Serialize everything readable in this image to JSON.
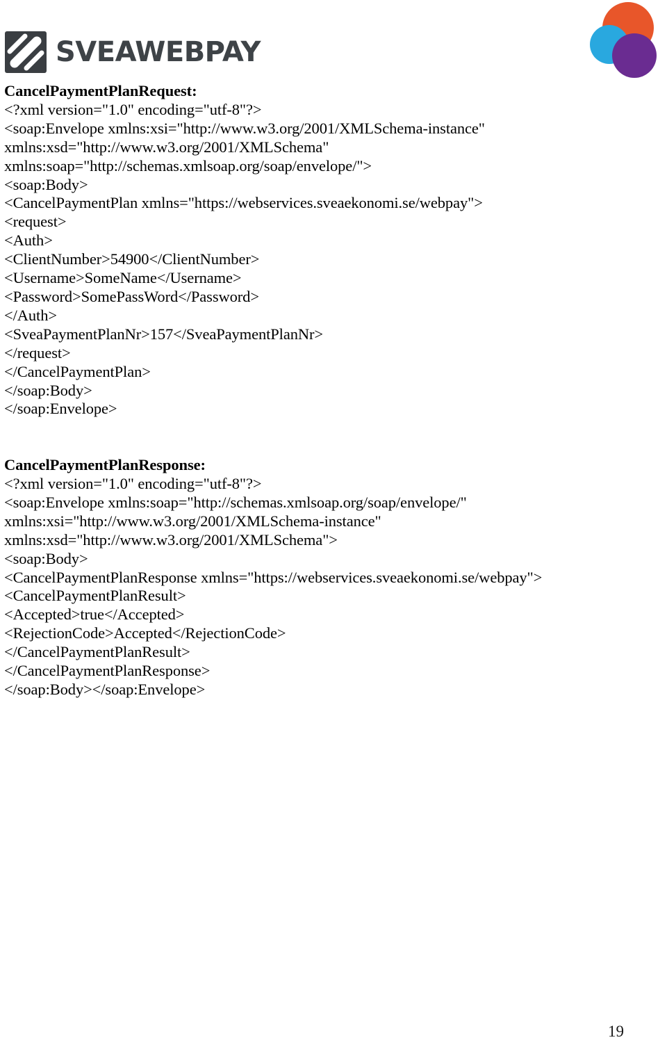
{
  "document": {
    "page_number": "19",
    "brand": {
      "name": "SVEAWEBPAY",
      "mark_color": "#3a3e42",
      "wordmark_color": "#3e4347",
      "venn_colors": {
        "orange": "#e8562a",
        "blue": "#29a8df",
        "purple": "#6a2c91"
      }
    },
    "request_section": {
      "title": "CancelPaymentPlanRequest:",
      "lines": [
        "<?xml version=\"1.0\" encoding=\"utf-8\"?>",
        "<soap:Envelope xmlns:xsi=\"http://www.w3.org/2001/XMLSchema-instance\"",
        "xmlns:xsd=\"http://www.w3.org/2001/XMLSchema\"",
        "xmlns:soap=\"http://schemas.xmlsoap.org/soap/envelope/\">",
        "<soap:Body>",
        "<CancelPaymentPlan xmlns=\"https://webservices.sveaekonomi.se/webpay\">",
        "<request>",
        "<Auth>",
        "<ClientNumber>54900</ClientNumber>",
        "<Username>SomeName</Username>",
        "<Password>SomePassWord</Password>",
        "</Auth>",
        "<SveaPaymentPlanNr>157</SveaPaymentPlanNr>",
        "</request>",
        "</CancelPaymentPlan>",
        "</soap:Body>",
        "</soap:Envelope>"
      ]
    },
    "response_section": {
      "title": "CancelPaymentPlanResponse:",
      "lines": [
        "<?xml version=\"1.0\" encoding=\"utf-8\"?>",
        "<soap:Envelope xmlns:soap=\"http://schemas.xmlsoap.org/soap/envelope/\"",
        "xmlns:xsi=\"http://www.w3.org/2001/XMLSchema-instance\"",
        "xmlns:xsd=\"http://www.w3.org/2001/XMLSchema\">",
        "<soap:Body>",
        "<CancelPaymentPlanResponse xmlns=\"https://webservices.sveaekonomi.se/webpay\">",
        "<CancelPaymentPlanResult>",
        "<Accepted>true</Accepted>",
        "<RejectionCode>Accepted</RejectionCode>",
        "</CancelPaymentPlanResult>",
        "</CancelPaymentPlanResponse>",
        "</soap:Body></soap:Envelope>"
      ]
    }
  }
}
